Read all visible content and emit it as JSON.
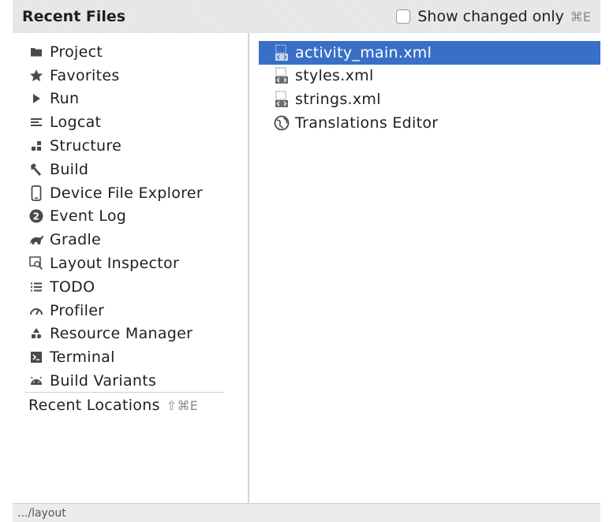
{
  "header": {
    "title": "Recent Files",
    "show_changed_label": "Show changed only",
    "show_changed_shortcut": "⌘E"
  },
  "tool_windows": [
    {
      "label": "Project",
      "icon": "folder-icon"
    },
    {
      "label": "Favorites",
      "icon": "star-icon"
    },
    {
      "label": "Run",
      "icon": "play-icon"
    },
    {
      "label": "Logcat",
      "icon": "logcat-icon"
    },
    {
      "label": "Structure",
      "icon": "structure-icon"
    },
    {
      "label": "Build",
      "icon": "hammer-icon"
    },
    {
      "label": "Device File Explorer",
      "icon": "phone-icon"
    },
    {
      "label": "Event Log",
      "icon": "event-log-icon",
      "badge": "2"
    },
    {
      "label": "Gradle",
      "icon": "gradle-icon"
    },
    {
      "label": "Layout Inspector",
      "icon": "layout-inspector-icon"
    },
    {
      "label": "TODO",
      "icon": "todo-list-icon"
    },
    {
      "label": "Profiler",
      "icon": "gauge-icon"
    },
    {
      "label": "Resource Manager",
      "icon": "resource-manager-icon"
    },
    {
      "label": "Terminal",
      "icon": "terminal-icon"
    },
    {
      "label": "Build Variants",
      "icon": "android-icon"
    }
  ],
  "recent_locations": {
    "label": "Recent Locations",
    "shortcut": "⇧⌘E"
  },
  "files": [
    {
      "name": "activity_main.xml",
      "icon": "xml-file-icon",
      "selected": true
    },
    {
      "name": "styles.xml",
      "icon": "xml-file-icon",
      "selected": false
    },
    {
      "name": "strings.xml",
      "icon": "xml-file-icon",
      "selected": false
    },
    {
      "name": "Translations Editor",
      "icon": "globe-icon",
      "selected": false
    }
  ],
  "status_bar": {
    "path": ".../layout"
  },
  "colors": {
    "selection": "#3a6fc7",
    "header_bg": "#e9e9e9",
    "icon": "#4a4a4a"
  }
}
